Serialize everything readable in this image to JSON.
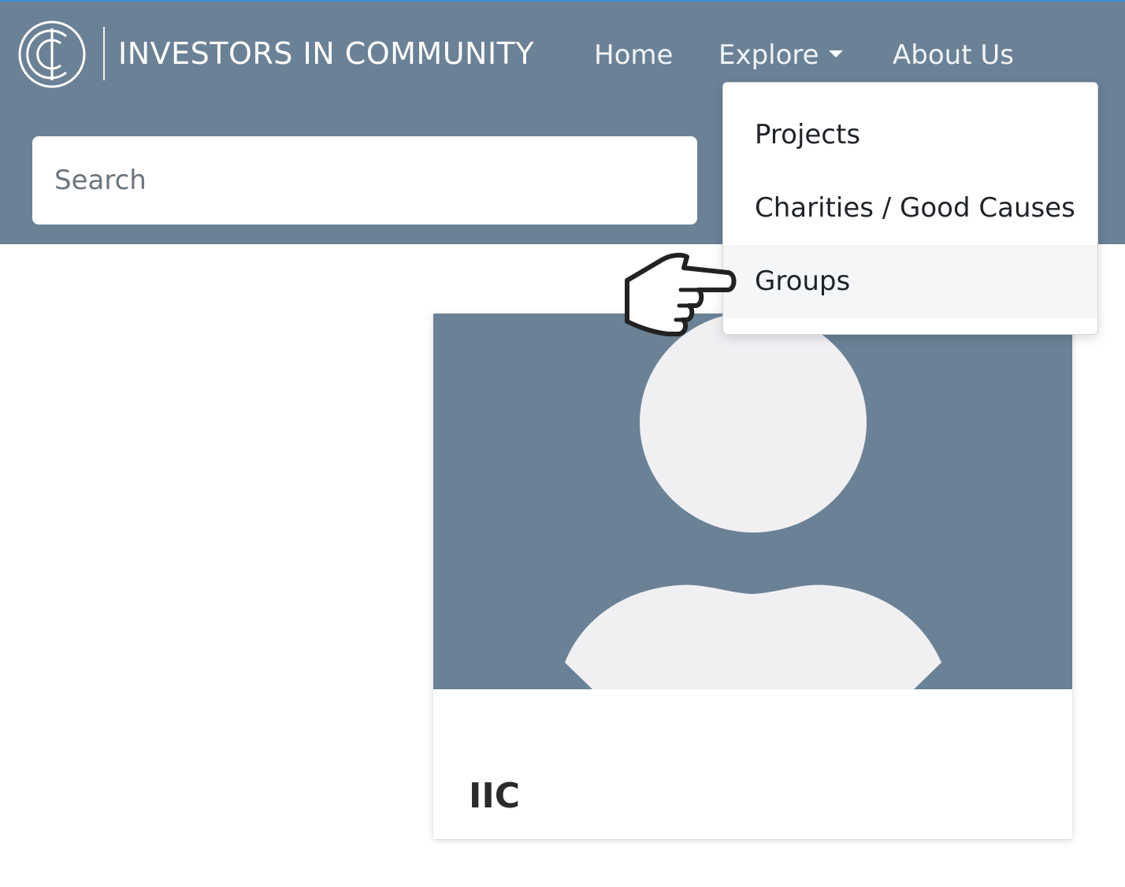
{
  "brand": {
    "name": "INVESTORS IN COMMUNITY",
    "logo_icon": "iic-circle-logo-icon"
  },
  "nav": {
    "home": "Home",
    "explore": "Explore",
    "about": "About Us"
  },
  "search": {
    "placeholder": "Search"
  },
  "dropdown": {
    "items": [
      {
        "label": "Projects"
      },
      {
        "label": "Charities / Good Causes"
      },
      {
        "label": "Groups",
        "hovered": true
      }
    ]
  },
  "card": {
    "title": "IIC",
    "image_icon": "default-avatar-icon"
  },
  "cursor": {
    "icon": "hand-pointer-icon"
  },
  "colors": {
    "header": "#6b8196",
    "top_accent": "#3b8fd9",
    "avatar_fill": "#f0f0f3"
  }
}
